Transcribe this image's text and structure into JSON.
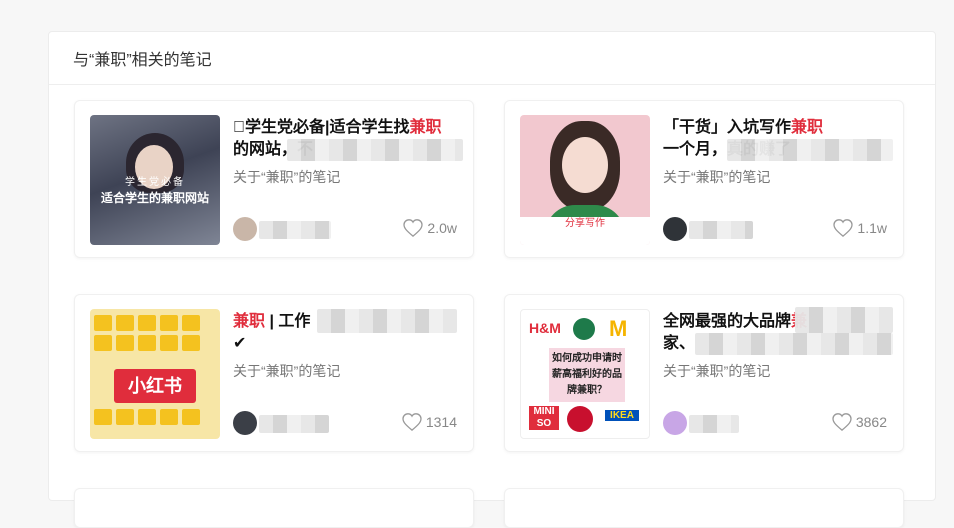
{
  "header": {
    "title": "与“兼职”相关的笔记"
  },
  "notes": [
    {
      "title_pre": "􏰀学生党必备|适合学生找",
      "title_kw": "兼职",
      "title_post": "的网站，不",
      "subtitle": "关于“兼职”的笔记",
      "likes": "2.0w",
      "thumb": {
        "line1": "学生党必备",
        "line2": "适合学生的兼职网站"
      },
      "avatar_color": "#c9b6a8"
    },
    {
      "title_pre": "「干货」入坑写作",
      "title_kw": "兼职",
      "title_post": "一个月，真的赚了",
      "subtitle": "关于“兼职”的笔记",
      "likes": "1.1w",
      "thumb": {
        "note": "分享写作"
      },
      "avatar_color": "#2f3338"
    },
    {
      "title_pre": "",
      "title_kw": "兼职",
      "title_post": " | 工作",
      "title_line2": "✔",
      "subtitle": "关于“兼职”的笔记",
      "likes": "1314",
      "thumb": {
        "logo": "小红书"
      },
      "avatar_color": "#3b3f47"
    },
    {
      "title_pre": "全网最强的大品牌",
      "title_kw": "兼",
      "title_post": "",
      "title_line2": "家、",
      "subtitle": "关于“兼职”的笔记",
      "likes": "3862",
      "thumb": {
        "mid": "如何成功申请时薪高福利好的品牌兼职？",
        "hm": "H&M",
        "mini": "MINI SO",
        "ikea": "IKEA"
      },
      "avatar_color": "#c8a6e6"
    }
  ],
  "colors": {
    "keyword": "#e02d3c",
    "panel_bg": "#ffffff",
    "page_bg": "#f7f7f7"
  },
  "icons": {
    "likes": "heart-outline-icon"
  }
}
